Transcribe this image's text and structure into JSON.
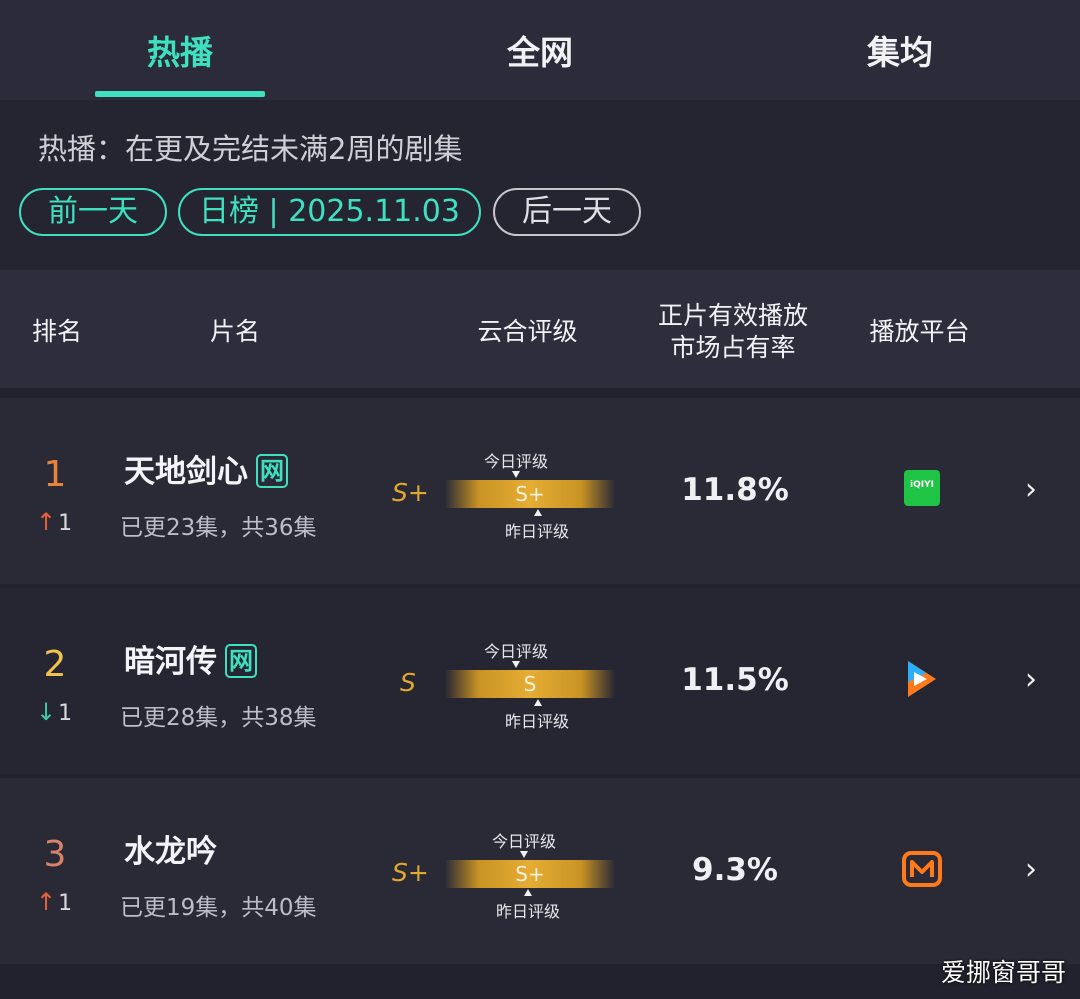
{
  "tabs": [
    {
      "label": "热播",
      "active": true
    },
    {
      "label": "全网",
      "active": false
    },
    {
      "label": "集均",
      "active": false
    }
  ],
  "description": "热播：在更及完结未满2周的剧集",
  "nav": {
    "prev_label": "前一天",
    "current_label": "日榜 | 2025.11.03",
    "next_label": "后一天"
  },
  "columns": {
    "rank": "排名",
    "title": "片名",
    "rating": "云合评级",
    "share_line1": "正片有效播放",
    "share_line2": "市场占有率",
    "platform": "播放平台"
  },
  "rating_labels": {
    "today": "今日评级",
    "yesterday": "昨日评级"
  },
  "rows": [
    {
      "rank": "1",
      "rank_color": "#e8843a",
      "change_dir": "up",
      "change_arrow": "↑",
      "change": "1",
      "title": "天地剑心",
      "tag": "网",
      "episodes": "已更23集，共36集",
      "grade_yesterday": "S+",
      "grade_today": "S+",
      "share": "11.8%",
      "platform_icon": "iqiyi-icon",
      "platform_text": "iQIYI"
    },
    {
      "rank": "2",
      "rank_color": "#f1c24a",
      "change_dir": "down",
      "change_arrow": "↓",
      "change": "1",
      "title": "暗河传",
      "tag": "网",
      "episodes": "已更28集，共38集",
      "grade_yesterday": "S",
      "grade_today": "S",
      "share": "11.5%",
      "platform_icon": "tencent-video-icon",
      "platform_text": ""
    },
    {
      "rank": "3",
      "rank_color": "#d8826a",
      "change_dir": "up",
      "change_arrow": "↑",
      "change": "1",
      "title": "水龙吟",
      "tag": "",
      "episodes": "已更19集，共40集",
      "grade_yesterday": "S+",
      "grade_today": "S+",
      "share": "9.3%",
      "platform_icon": "mango-tv-icon",
      "platform_text": ""
    }
  ],
  "colors": {
    "accent": "#3fe0c0",
    "grade": "#e0a82e",
    "up": "#e8603a",
    "down": "#3fc8a8"
  },
  "watermark": "爱挪窗哥哥"
}
